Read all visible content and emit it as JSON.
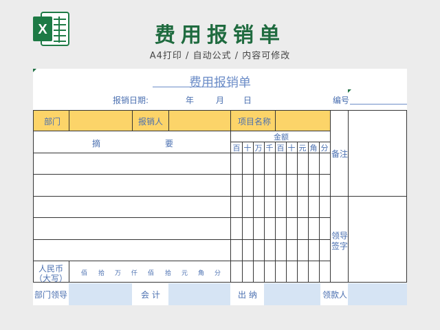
{
  "header": {
    "title": "费用报销单",
    "subtitle": "A4打印 / 自动公式 / 内容可修改",
    "logo_icon": "excel-icon",
    "brand_color": "#1f6b3f"
  },
  "form": {
    "title": "费用报销单",
    "date_label": "报销日期:",
    "year": "年",
    "month": "月",
    "day": "日",
    "number_label": "编号",
    "dept": "部门",
    "reporter": "报销人",
    "project": "项目名称",
    "amount": "金额",
    "summary_left": "摘",
    "summary_right": "要",
    "remarks": "备注",
    "leader_sign_1": "领导",
    "leader_sign_2": "签字",
    "rmb_1": "人民币",
    "rmb_2": "（大写）",
    "amount_columns": [
      "百",
      "十",
      "万",
      "千",
      "百",
      "十",
      "元",
      "角",
      "分"
    ],
    "uppercase_units": [
      "佰",
      "拾",
      "万",
      "仟",
      "佰",
      "拾",
      "元",
      "角",
      "分"
    ],
    "footer": {
      "dept_leader": "部门领导",
      "accountant": "会 计",
      "cashier": "出 纳",
      "receiver": "领款人"
    },
    "colors": {
      "highlight": "#fcd469",
      "footer_fill": "#d6e4f4",
      "text": "#4a6fb0"
    }
  }
}
